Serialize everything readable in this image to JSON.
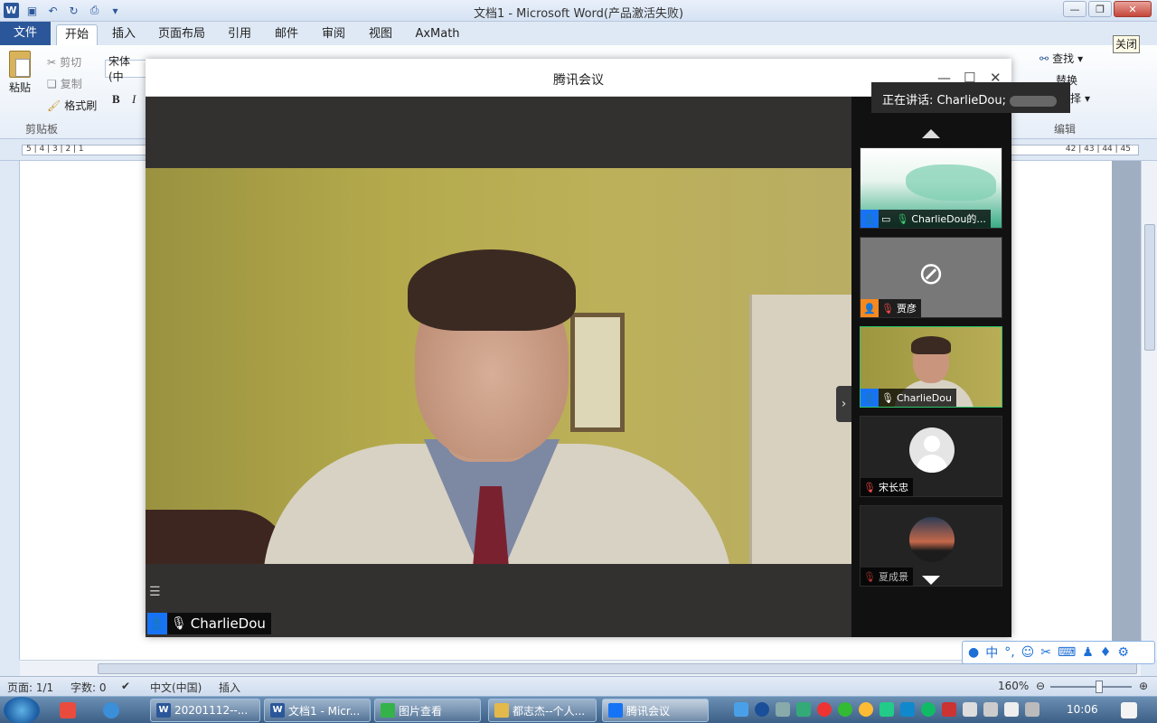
{
  "word": {
    "title": "文档1 - Microsoft Word(产品激活失败)",
    "tabs": [
      "文件",
      "开始",
      "插入",
      "页面布局",
      "引用",
      "邮件",
      "审阅",
      "视图",
      "AxMath"
    ],
    "clipboard": {
      "paste": "粘贴",
      "cut": "剪切",
      "copy": "复制",
      "format_painter": "格式刷",
      "group": "剪贴板"
    },
    "font_name": "宋体 (中",
    "bold": "B",
    "italic": "I",
    "editing": {
      "find": "查找",
      "replace": "替换",
      "select": "择",
      "group": "编辑"
    },
    "tooltip": "关闭",
    "ruler_left": "5 | 4 | 3 | 2 | 1",
    "ruler_right": "42 | 43 | 44 | 45",
    "status": {
      "page": "页面: 1/1",
      "words": "字数: 0",
      "language": "中文(中国)",
      "insert": "插入",
      "zoom": "160%"
    }
  },
  "meeting": {
    "title": "腾讯会议",
    "speaking": "正在讲话: CharlieDou;",
    "main_speaker": "CharlieDou",
    "participants": [
      {
        "name": "CharlieDou的...",
        "kind": "share"
      },
      {
        "name": "贾彦",
        "kind": "camera-off"
      },
      {
        "name": "CharlieDou",
        "kind": "camera"
      },
      {
        "name": "宋长忠",
        "kind": "avatar"
      },
      {
        "name": "夏成景",
        "kind": "photo"
      }
    ]
  },
  "ime": {
    "lang": "中"
  },
  "taskbar": {
    "tasks": [
      "20201112--...",
      "文档1 - Micr...",
      "图片查看",
      "都志杰--个人...",
      "腾讯会议"
    ],
    "clock": "10:06"
  },
  "colors": {
    "word_blue": "#2b579a",
    "meeting_accent": "#1673f5",
    "active_green": "#2fc46a"
  }
}
